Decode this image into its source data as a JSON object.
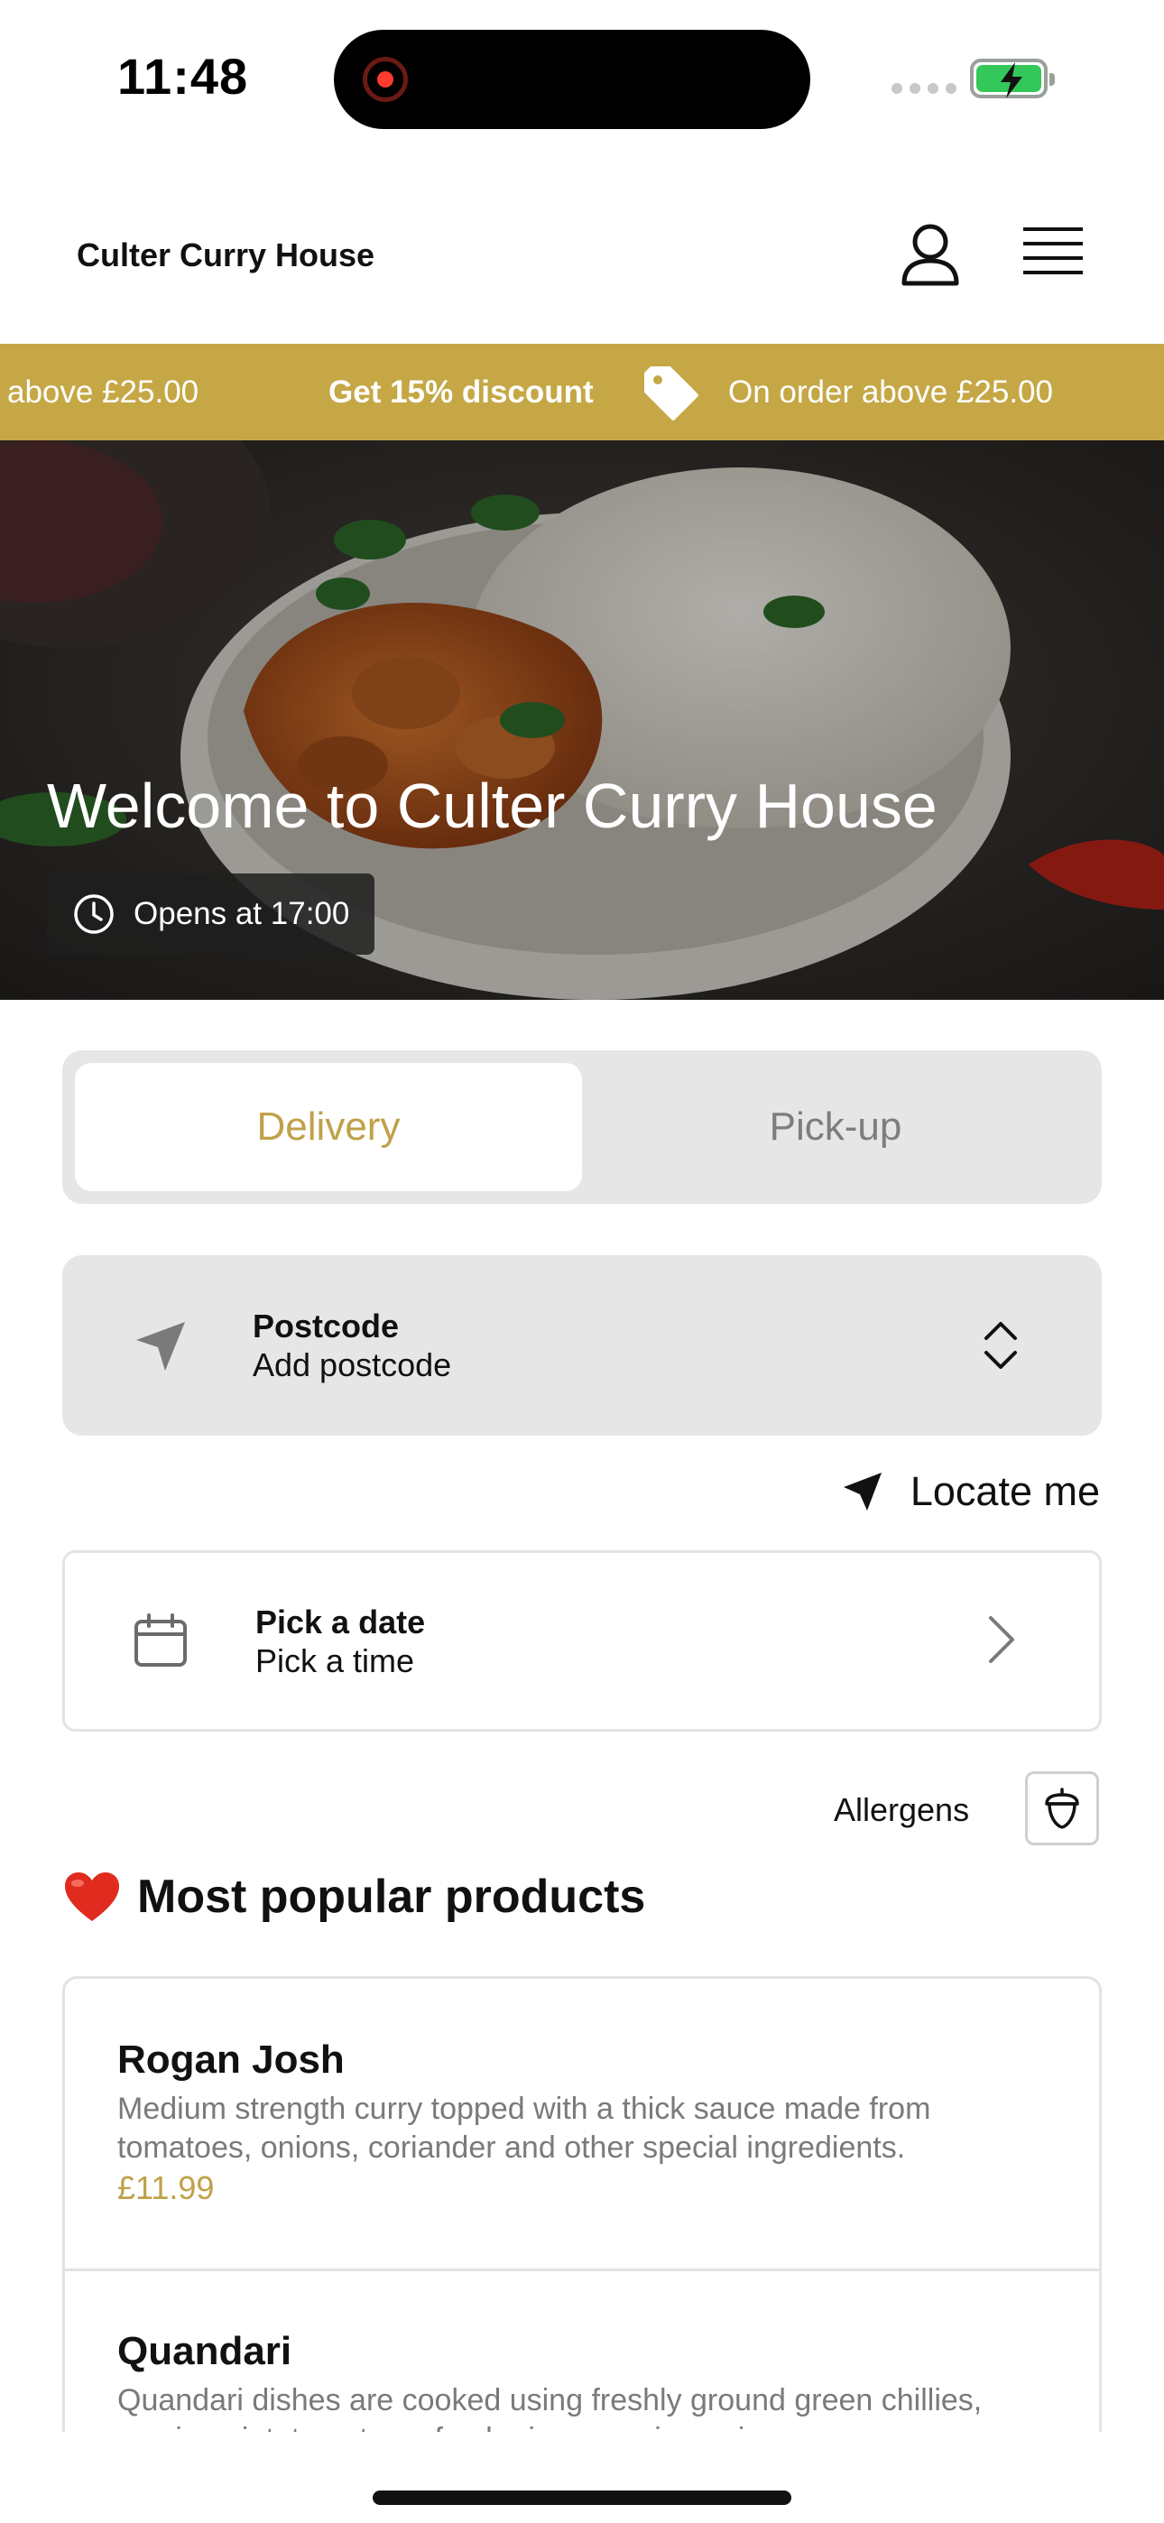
{
  "status_bar": {
    "time": "11:48"
  },
  "header": {
    "brand": "Culter Curry House"
  },
  "promo": {
    "left_fragment": "above £25.00",
    "headline": "Get 15% discount",
    "condition": "On order above £25.00"
  },
  "hero": {
    "title": "Welcome to Culter Curry House",
    "hours": "Opens at 17:00"
  },
  "order_mode": {
    "delivery_label": "Delivery",
    "pickup_label": "Pick-up",
    "selected": "Delivery"
  },
  "postcode": {
    "label": "Postcode",
    "value": "Add postcode"
  },
  "locate": {
    "label": "Locate me"
  },
  "schedule": {
    "date_label": "Pick a date",
    "time_label": "Pick a time"
  },
  "allergens": {
    "label": "Allergens"
  },
  "popular": {
    "title": "Most popular products",
    "products": [
      {
        "name": "Rogan Josh",
        "description": "Medium strength curry topped with a thick sauce made from tomatoes, onions, coriander and other special ingredients.",
        "price": "£11.99"
      },
      {
        "name": "Quandari",
        "description": "Quandari dishes are cooked using freshly ground green chillies, cumin, mint, tomatoes, fresh ginger, spring onions a"
      }
    ]
  },
  "colors": {
    "accent": "#c5a745",
    "accent_text": "#bfa148",
    "panel": "#e6e6e6"
  }
}
